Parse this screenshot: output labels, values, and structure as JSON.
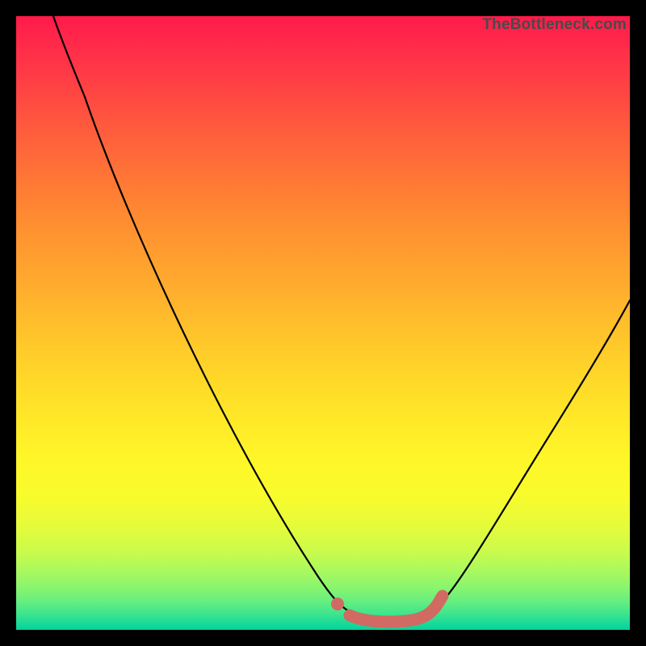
{
  "watermark": "TheBottleneck.com",
  "colors": {
    "gradient_top": "#ff1a4a",
    "gradient_mid": "#ffe928",
    "gradient_bottom": "#05d29d",
    "curve": "#000000",
    "marker": "#d16a63",
    "frame": "#000000"
  },
  "chart_data": {
    "type": "line",
    "title": "",
    "xlabel": "",
    "ylabel": "",
    "xlim": [
      0,
      100
    ],
    "ylim": [
      0,
      100
    ],
    "series": [
      {
        "name": "bottleneck-curve",
        "x": [
          6,
          10,
          15,
          20,
          25,
          30,
          35,
          40,
          45,
          50,
          52,
          55,
          58,
          62,
          65,
          70,
          75,
          80,
          85,
          90,
          95,
          100
        ],
        "y": [
          100,
          91,
          82,
          73,
          64,
          55,
          46,
          37,
          28,
          15,
          8,
          3,
          1,
          0.5,
          1,
          4,
          10,
          18,
          27,
          36,
          45,
          54
        ]
      }
    ],
    "highlight": {
      "name": "optimal-range",
      "x": [
        52,
        56,
        60,
        64,
        68
      ],
      "y": [
        6,
        3,
        1,
        1,
        2
      ]
    }
  }
}
